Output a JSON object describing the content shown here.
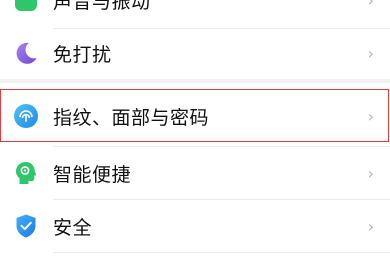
{
  "settings": {
    "items": [
      {
        "label": "声音与振动",
        "icon": "sound-icon",
        "color": "#2fc56b"
      },
      {
        "label": "免打扰",
        "icon": "moon-icon",
        "color": "#8a63e0"
      },
      {
        "label": "指纹、面部与密码",
        "icon": "fingerprint-face-icon",
        "color": "#2b9fe6"
      },
      {
        "label": "智能便捷",
        "icon": "smart-head-icon",
        "color": "#2fc56b"
      },
      {
        "label": "安全",
        "icon": "shield-check-icon",
        "color": "#2b8ff0"
      }
    ],
    "chevron": "›"
  }
}
